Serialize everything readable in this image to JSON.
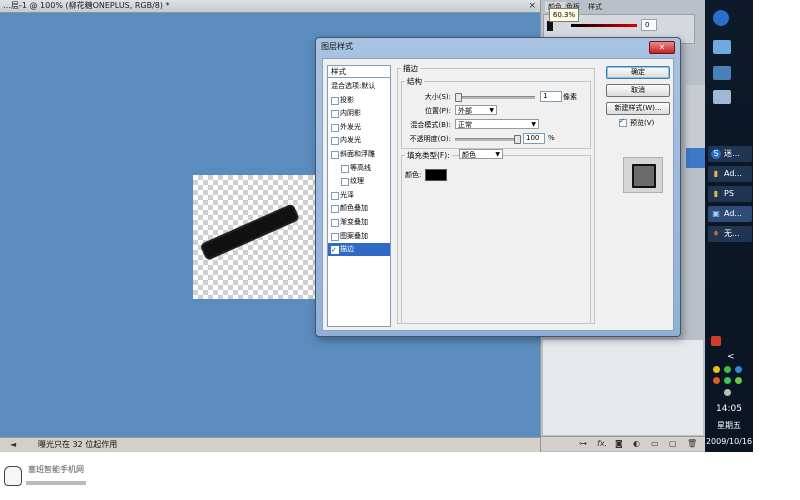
{
  "document": {
    "title": "…层-1 @ 100% (柳花糖ONEPLUS, RGB/8) *",
    "close_glyph": "×",
    "status_arrow_glyph": "◄",
    "status_text": "曝光只在 32 位起作用"
  },
  "panels": {
    "tabs": [
      "颜色",
      "色板",
      "样式"
    ],
    "zoom_tooltip": "60.3%",
    "red_value": "0"
  },
  "dialog": {
    "title": "图层样式",
    "close_glyph": "✕",
    "style_list_header": "样式",
    "style_items": [
      {
        "label": "混合选项:默认",
        "checkbox": false,
        "checked": false,
        "indent": false,
        "selected": false
      },
      {
        "label": "投影",
        "checkbox": true,
        "checked": false,
        "indent": false,
        "selected": false
      },
      {
        "label": "内阴影",
        "checkbox": true,
        "checked": false,
        "indent": false,
        "selected": false
      },
      {
        "label": "外发光",
        "checkbox": true,
        "checked": false,
        "indent": false,
        "selected": false
      },
      {
        "label": "内发光",
        "checkbox": true,
        "checked": false,
        "indent": false,
        "selected": false
      },
      {
        "label": "斜面和浮雕",
        "checkbox": true,
        "checked": false,
        "indent": false,
        "selected": false
      },
      {
        "label": "等高线",
        "checkbox": true,
        "checked": false,
        "indent": true,
        "selected": false
      },
      {
        "label": "纹理",
        "checkbox": true,
        "checked": false,
        "indent": true,
        "selected": false
      },
      {
        "label": "光泽",
        "checkbox": true,
        "checked": false,
        "indent": false,
        "selected": false
      },
      {
        "label": "颜色叠加",
        "checkbox": true,
        "checked": false,
        "indent": false,
        "selected": false
      },
      {
        "label": "渐变叠加",
        "checkbox": true,
        "checked": false,
        "indent": false,
        "selected": false
      },
      {
        "label": "图案叠加",
        "checkbox": true,
        "checked": false,
        "indent": false,
        "selected": false
      },
      {
        "label": "描边",
        "checkbox": true,
        "checked": true,
        "indent": false,
        "selected": true
      }
    ],
    "stroke": {
      "section_title": "描边",
      "structure_title": "结构",
      "size_label": "大小(S):",
      "size_value": "1",
      "size_unit": "像素",
      "position_label": "位置(P):",
      "position_value": "外部",
      "blend_label": "混合模式(B):",
      "blend_value": "正常",
      "opacity_label": "不透明度(O):",
      "opacity_value": "100",
      "opacity_unit": "%",
      "fill_type_label": "填充类型(F):",
      "fill_type_value": "颜色",
      "color_label": "颜色:",
      "stroke_color": "#000000",
      "size_slider_level": 0.0,
      "opacity_slider_level": 1.0
    },
    "buttons": {
      "ok": "确定",
      "cancel": "取消",
      "new_style": "新建样式(W)...",
      "preview_label": "预览(V)",
      "preview_checked": true
    }
  },
  "sidebar": {
    "tasks": [
      {
        "icon": "S",
        "label": "迷…",
        "icon_color": "#2a6fc9"
      },
      {
        "icon": "▮",
        "label": "Ad...",
        "icon_color": "#e8b44a"
      },
      {
        "icon": "▮",
        "label": "PS",
        "icon_color": "#e8b44a"
      },
      {
        "icon": "▣",
        "label": "Ad...",
        "icon_color": "#2b5fa6"
      },
      {
        "icon": "♦",
        "label": "无...",
        "icon_color": "#c96a2a"
      }
    ],
    "expand_arrow": "<",
    "time": "14:05",
    "weekday": "星期五",
    "date": "2009/10/16"
  },
  "watermark": {
    "site_text": "塞班智能手机网"
  },
  "colors": {
    "canvas_bg": "#5b8cbe",
    "dialog_frame": "#9fbbdc",
    "selection": "#316ac5"
  }
}
